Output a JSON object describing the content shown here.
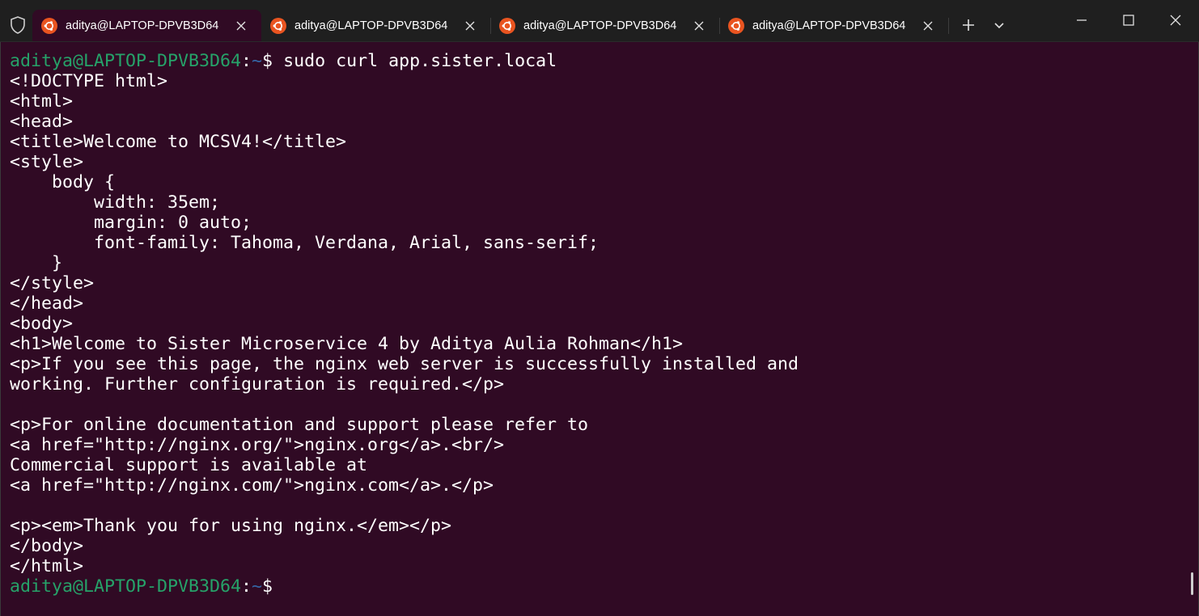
{
  "tabs": [
    {
      "title": "aditya@LAPTOP-DPVB3D64",
      "active": true
    },
    {
      "title": "aditya@LAPTOP-DPVB3D64",
      "active": false
    },
    {
      "title": "aditya@LAPTOP-DPVB3D64",
      "active": false
    },
    {
      "title": "aditya@LAPTOP-DPVB3D64",
      "active": false
    }
  ],
  "toolbar": {
    "new_tab_icon": "plus-icon",
    "dropdown_icon": "chevron-down-icon"
  },
  "window_controls": [
    "minimize-icon",
    "maximize-icon",
    "close-icon"
  ],
  "terminal": {
    "prompt": {
      "user_host": "aditya@LAPTOP-DPVB3D64",
      "colon": ":",
      "path": "~",
      "dollar": "$"
    },
    "command": " sudo curl app.sister.local",
    "output": [
      "<!DOCTYPE html>",
      "<html>",
      "<head>",
      "<title>Welcome to MCSV4!</title>",
      "<style>",
      "    body {",
      "        width: 35em;",
      "        margin: 0 auto;",
      "        font-family: Tahoma, Verdana, Arial, sans-serif;",
      "    }",
      "</style>",
      "</head>",
      "<body>",
      "<h1>Welcome to Sister Microservice 4 by Aditya Aulia Rohman</h1>",
      "<p>If you see this page, the nginx web server is successfully installed and",
      "working. Further configuration is required.</p>",
      "",
      "<p>For online documentation and support please refer to",
      "<a href=\"http://nginx.org/\">nginx.org</a>.<br/>",
      "Commercial support is available at",
      "<a href=\"http://nginx.com/\">nginx.com</a>.</p>",
      "",
      "<p><em>Thank you for using nginx.</em></p>",
      "</body>",
      "</html>"
    ],
    "final_command": ""
  },
  "colors": {
    "terminal_bg": "#300a24",
    "tabbar_bg": "#1f1f1f",
    "prompt_user": "#26a269",
    "prompt_path": "#3465a4",
    "ubuntu_orange": "#e95420"
  }
}
